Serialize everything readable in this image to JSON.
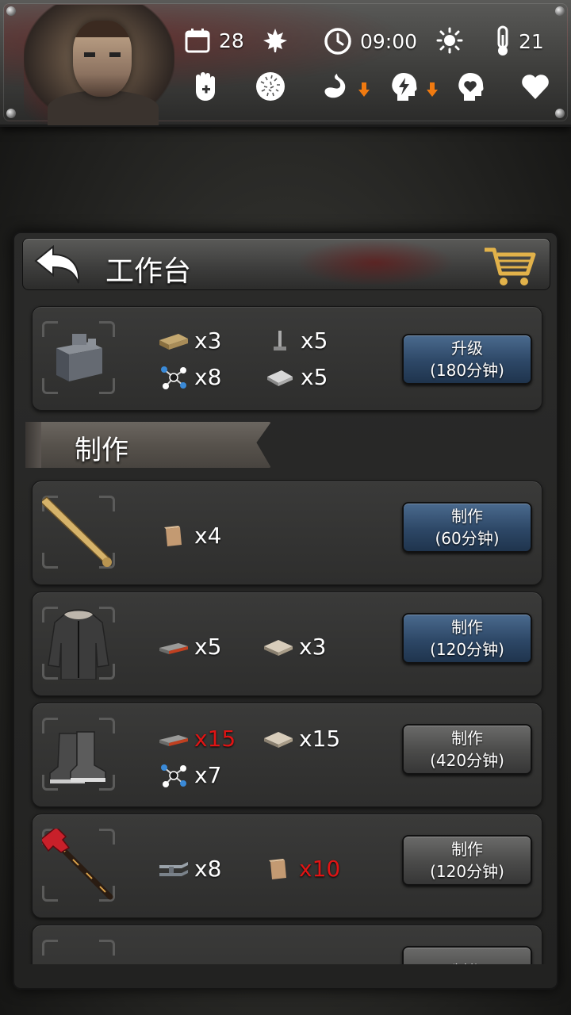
{
  "hud": {
    "day": "28",
    "time": "09:00",
    "temperature": "21",
    "season_icon": "maple-leaf-icon",
    "weather_icon": "sun-icon",
    "status_icons": [
      "medkit-glove-icon",
      "immunity-icon",
      "stomach-icon",
      "energy-head-icon",
      "mood-head-icon",
      "heart-icon"
    ]
  },
  "panel": {
    "title": "工作台",
    "upgrade": {
      "materials": [
        {
          "icon": "planks-icon",
          "qty": "x3",
          "short": false
        },
        {
          "icon": "nails-icon",
          "qty": "x5",
          "short": false
        },
        {
          "icon": "molecule-icon",
          "qty": "x8",
          "short": false
        },
        {
          "icon": "metal-sheet-icon",
          "qty": "x5",
          "short": false
        }
      ],
      "button": {
        "line1": "升级",
        "line2": "(180分钟)"
      }
    },
    "section_label": "制作",
    "recipes": [
      {
        "item": "baseball-bat",
        "materials": [
          {
            "icon": "wood-block-icon",
            "qty": "x4",
            "short": false
          }
        ],
        "button": {
          "line1": "制作",
          "line2": "(60分钟)",
          "style": "blue"
        }
      },
      {
        "item": "winter-jacket",
        "materials": [
          {
            "icon": "leather-icon",
            "qty": "x5",
            "short": false
          },
          {
            "icon": "cloth-icon",
            "qty": "x3",
            "short": false
          }
        ],
        "button": {
          "line1": "制作",
          "line2": "(120分钟)",
          "style": "blue"
        }
      },
      {
        "item": "boots",
        "materials": [
          {
            "icon": "leather-icon",
            "qty": "x15",
            "short": true
          },
          {
            "icon": "cloth-icon",
            "qty": "x15",
            "short": false
          },
          {
            "icon": "molecule-icon",
            "qty": "x7",
            "short": false
          }
        ],
        "button": {
          "line1": "制作",
          "line2": "(420分钟)",
          "style": "gray"
        }
      },
      {
        "item": "fire-axe",
        "materials": [
          {
            "icon": "steel-beam-icon",
            "qty": "x8",
            "short": false
          },
          {
            "icon": "wood-block-icon",
            "qty": "x10",
            "short": true
          }
        ],
        "button": {
          "line1": "制作",
          "line2": "(120分钟)",
          "style": "gray"
        }
      },
      {
        "item": "unknown-item",
        "materials": [],
        "button": {
          "line1": "制作",
          "line2": "",
          "style": "gray"
        }
      }
    ]
  },
  "colors": {
    "short_qty": "#e01414",
    "button_blue": "#2d4766"
  }
}
